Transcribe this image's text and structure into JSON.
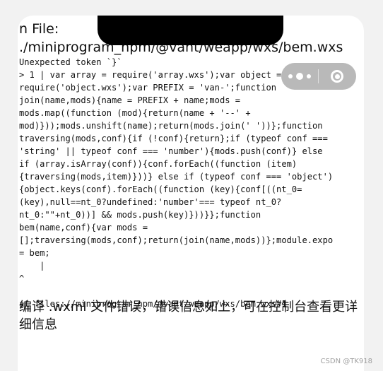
{
  "error_panel": {
    "title_line1": "n File:",
    "title_line2": "./miniprogram_npm/@vant/weapp/wxs/bem.wxs",
    "error_message": "Unexpected token `}`",
    "code_lines": [
      "> 1 | var array = require('array.wxs');var object =",
      "require('object.wxs');var PREFIX = 'van-';function",
      "join(name,mods){name = PREFIX + name;mods =",
      "mods.map((function (mod){return(name + '--' +",
      "mod)}));mods.unshift(name);return(mods.join(' '))};function",
      "traversing(mods,conf){if (!conf){return};if (typeof conf ===",
      "'string' || typeof conf === 'number'){mods.push(conf)} else",
      "if (array.isArray(conf)){conf.forEach((function (item)",
      "{traversing(mods,item)}))} else if (typeof conf === 'object')",
      "{object.keys(conf).forEach((function (key){conf[((nt_0=",
      "(key),null==nt_0?undefined:'number'=== typeof nt_0?",
      "nt_0:\"\"+nt_0))] && mods.push(key)}))}};function",
      "bem(name,conf){var mods =",
      "[];traversing(mods,conf);return(join(name,mods))};module.expo",
      "= bem;",
      "    |",
      "^"
    ],
    "location": "at files://miniprogram_npm/@vant/weapp/wxs/bem.wxs#1",
    "summary": "编译 .wxml 文件错误，错误信息如上，可在控制台查看更详细信息"
  },
  "capsule": {
    "more_icon": "more-dots-icon",
    "close_icon": "close-circle-icon"
  },
  "watermark": "CSDN @TK918"
}
